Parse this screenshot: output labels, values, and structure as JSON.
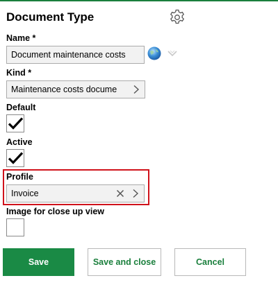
{
  "form": {
    "title": "Document Type",
    "settings_icon": "gear-icon"
  },
  "fields": {
    "name": {
      "label": "Name *",
      "value": "Document maintenance costs",
      "icons": [
        "globe-icon",
        "dropdown-chevron-icon"
      ]
    },
    "kind": {
      "label": "Kind *",
      "value": "Maintenance costs docume",
      "icon": "chevron-right-icon"
    },
    "default": {
      "label": "Default",
      "checked": true
    },
    "active": {
      "label": "Active",
      "checked": true
    },
    "profile": {
      "label": "Profile",
      "value": "Invoice",
      "icons": [
        "clear-x-icon",
        "chevron-right-icon"
      ],
      "highlight_color": "#d0121b"
    },
    "image_close_up": {
      "label": "Image for close up view",
      "checked": false
    }
  },
  "actions": {
    "save": "Save",
    "save_and_close": "Save and close",
    "cancel": "Cancel"
  },
  "colors": {
    "accent": "#1a7f3c",
    "primary_button": "#1a8a45"
  }
}
